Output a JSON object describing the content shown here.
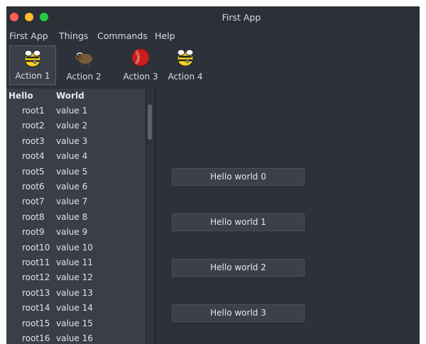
{
  "window": {
    "title": "First App"
  },
  "menu": [
    "First App",
    "Things",
    "Commands",
    "Help"
  ],
  "toolbar": {
    "actions": [
      {
        "label": "Action 1",
        "icon": "bee-icon"
      },
      {
        "label": "Action 2",
        "icon": "yak-icon"
      },
      {
        "label": "Action 3",
        "icon": "cricket-ball-icon"
      },
      {
        "label": "Action 4",
        "icon": "bee-icon"
      }
    ]
  },
  "tree": {
    "headers": [
      "Hello",
      "World"
    ],
    "rows": [
      [
        "root1",
        "value 1"
      ],
      [
        "root2",
        "value 2"
      ],
      [
        "root3",
        "value 3"
      ],
      [
        "root4",
        "value 4"
      ],
      [
        "root5",
        "value 5"
      ],
      [
        "root6",
        "value 6"
      ],
      [
        "root7",
        "value 7"
      ],
      [
        "root8",
        "value 8"
      ],
      [
        "root9",
        "value 9"
      ],
      [
        "root10",
        "value 10"
      ],
      [
        "root11",
        "value 11"
      ],
      [
        "root12",
        "value 12"
      ],
      [
        "root13",
        "value 13"
      ],
      [
        "root14",
        "value 14"
      ],
      [
        "root15",
        "value 15"
      ],
      [
        "root16",
        "value 16"
      ]
    ]
  },
  "buttons": [
    "Hello world 0",
    "Hello world 1",
    "Hello world 2",
    "Hello world 3"
  ],
  "colors": {
    "window_bg": "#2d3139",
    "panel_bg": "#3a3f47",
    "button_bg": "#3b4049"
  }
}
